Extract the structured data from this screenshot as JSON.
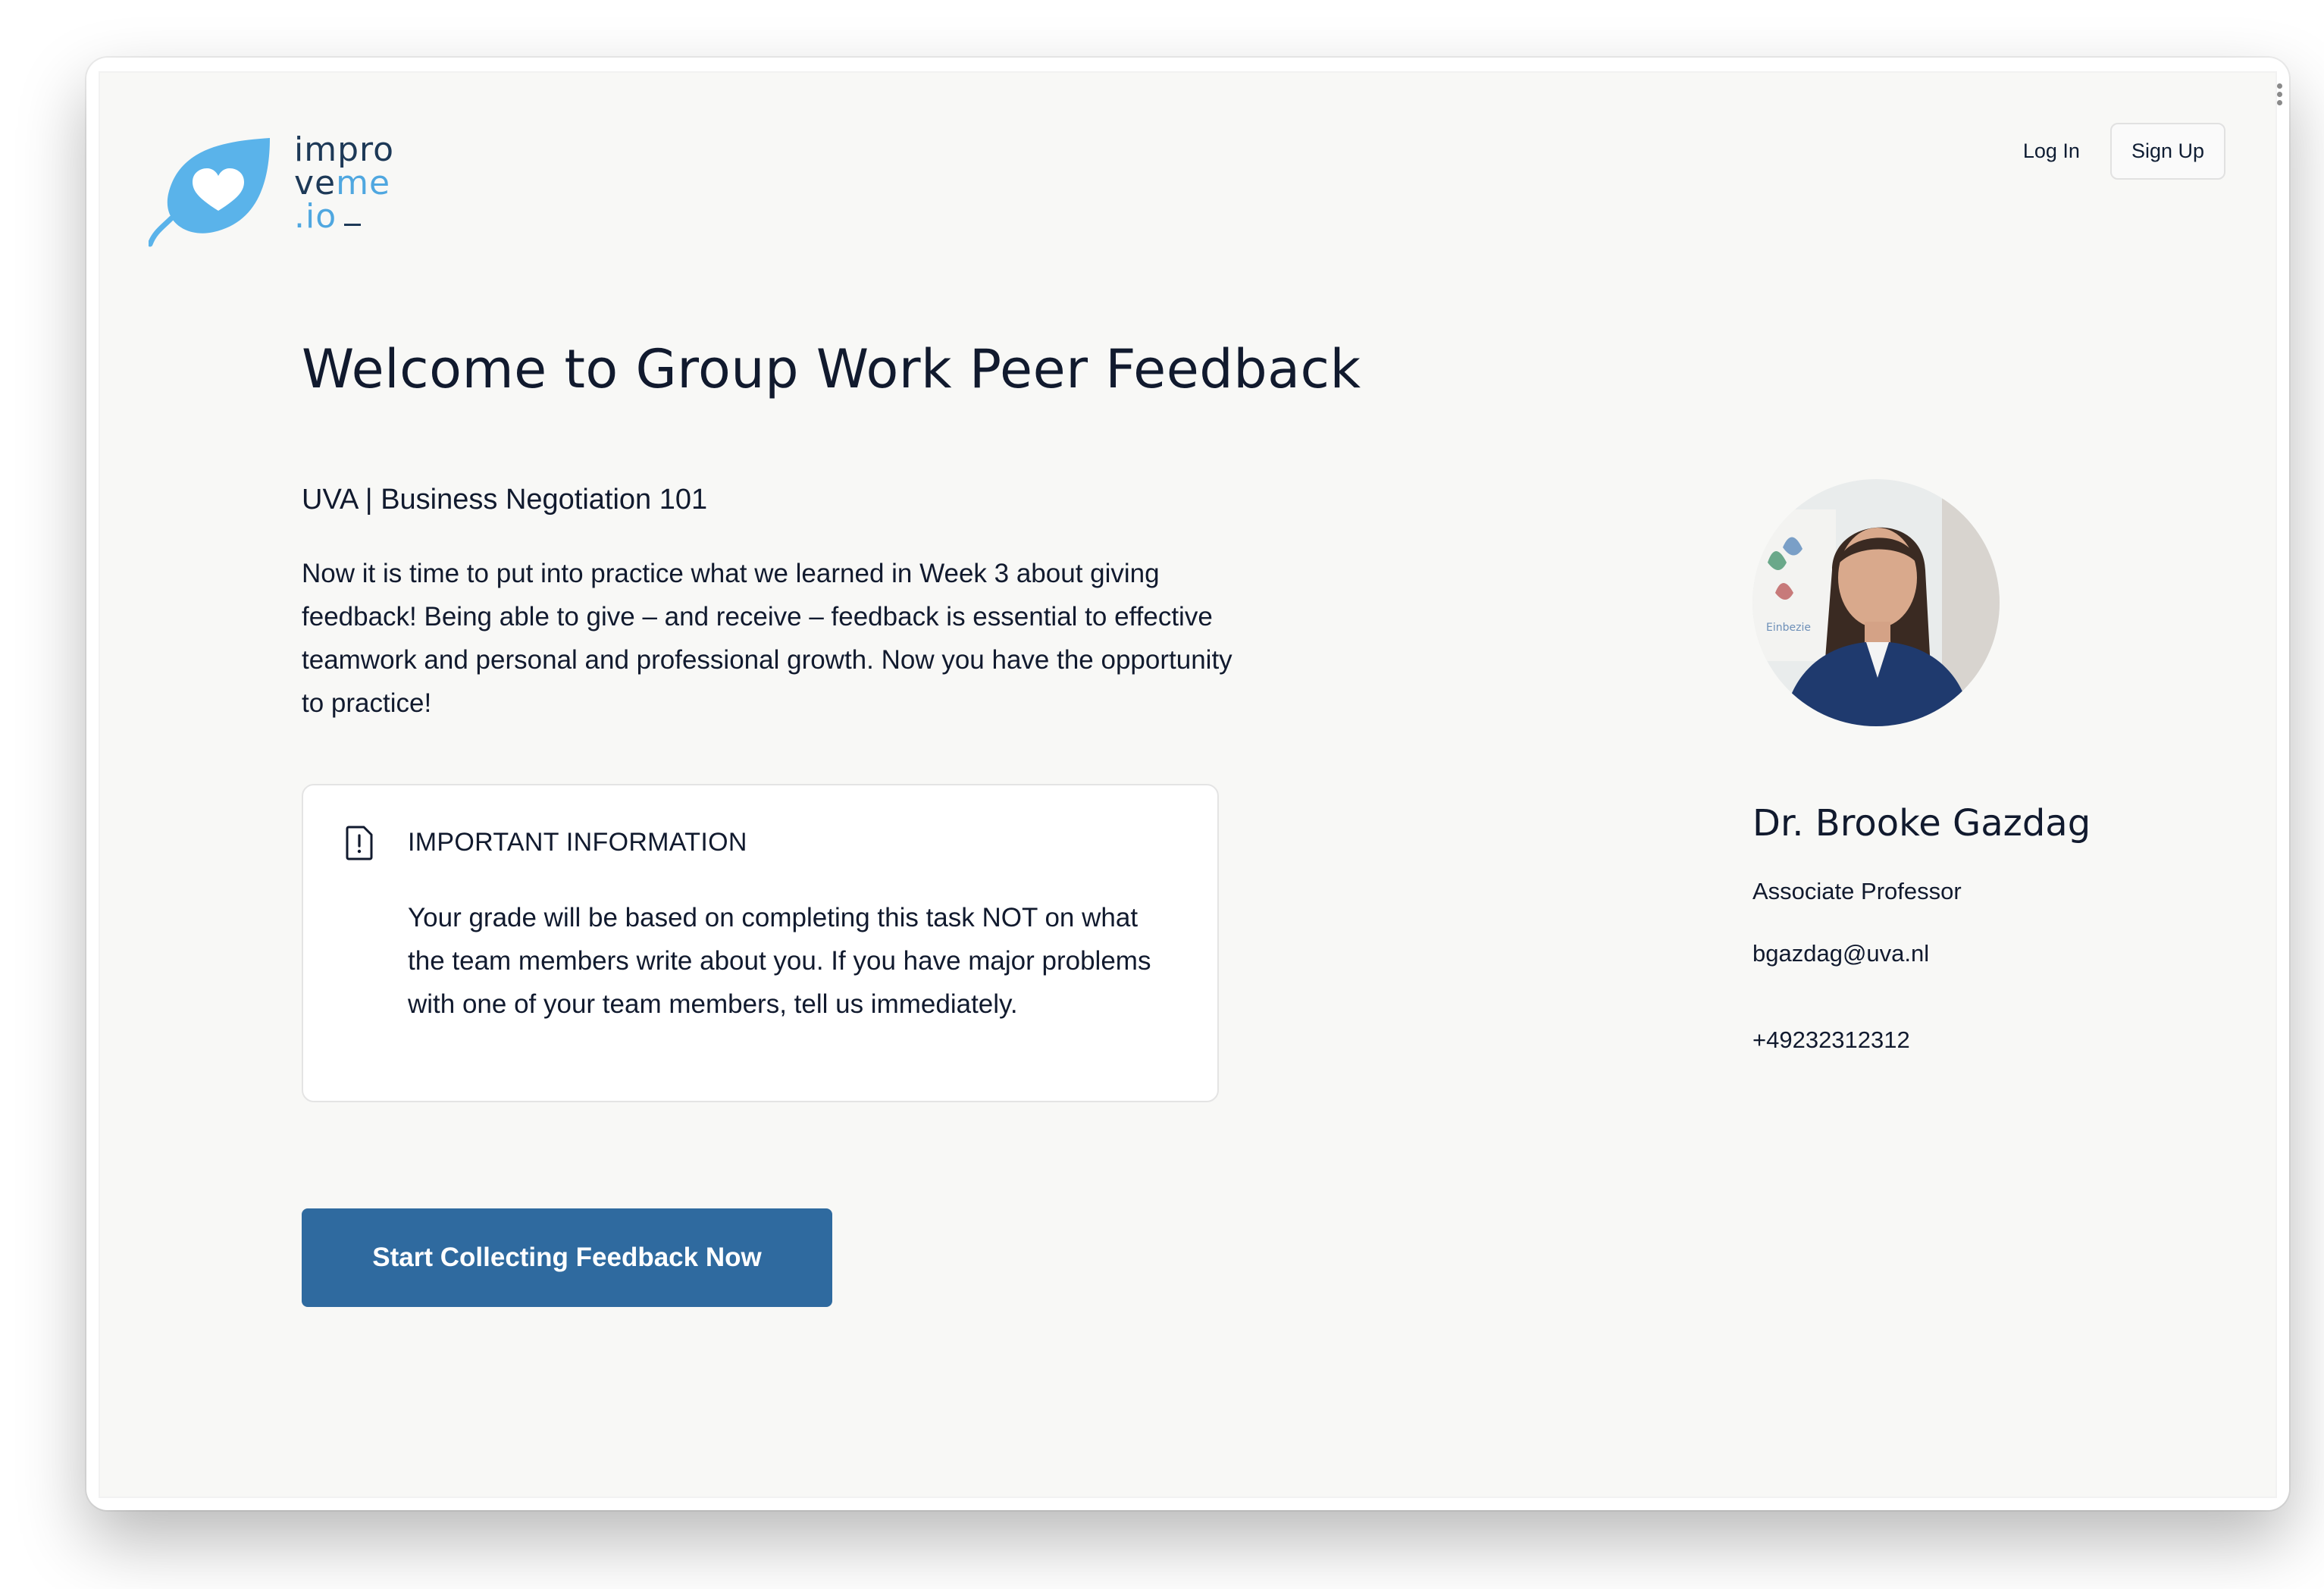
{
  "brand": {
    "logo_line1": "impro",
    "logo_line2_a": "ve",
    "logo_line2_b": "me",
    "logo_line3": ".io",
    "logo_icon": "heart-leaf-icon",
    "accent_color": "#4fa7e0",
    "dark_color": "#1d3957"
  },
  "nav": {
    "login_label": "Log In",
    "signup_label": "Sign Up"
  },
  "main": {
    "title": "Welcome to Group Work Peer Feedback",
    "course": "UVA | Business Negotiation 101",
    "intro": "Now it is time to put into practice what we learned in Week 3 about giving feedback! Being able to give – and receive – feedback is essential to effective teamwork and personal and professional growth. Now you have the opportunity to practice!",
    "info": {
      "icon": "alert-document-icon",
      "heading": "IMPORTANT INFORMATION",
      "body": "Your grade will be based on completing this task NOT on what the team members write about you. If you have major problems with one of your team members, tell us immediately."
    },
    "cta_label": "Start Collecting Feedback Now",
    "cta_color": "#2f6a9f"
  },
  "professor": {
    "name": "Dr. Brooke Gazdag",
    "title": "Associate Professor",
    "email": "bgazdag@uva.nl",
    "phone": "+49232312312"
  }
}
